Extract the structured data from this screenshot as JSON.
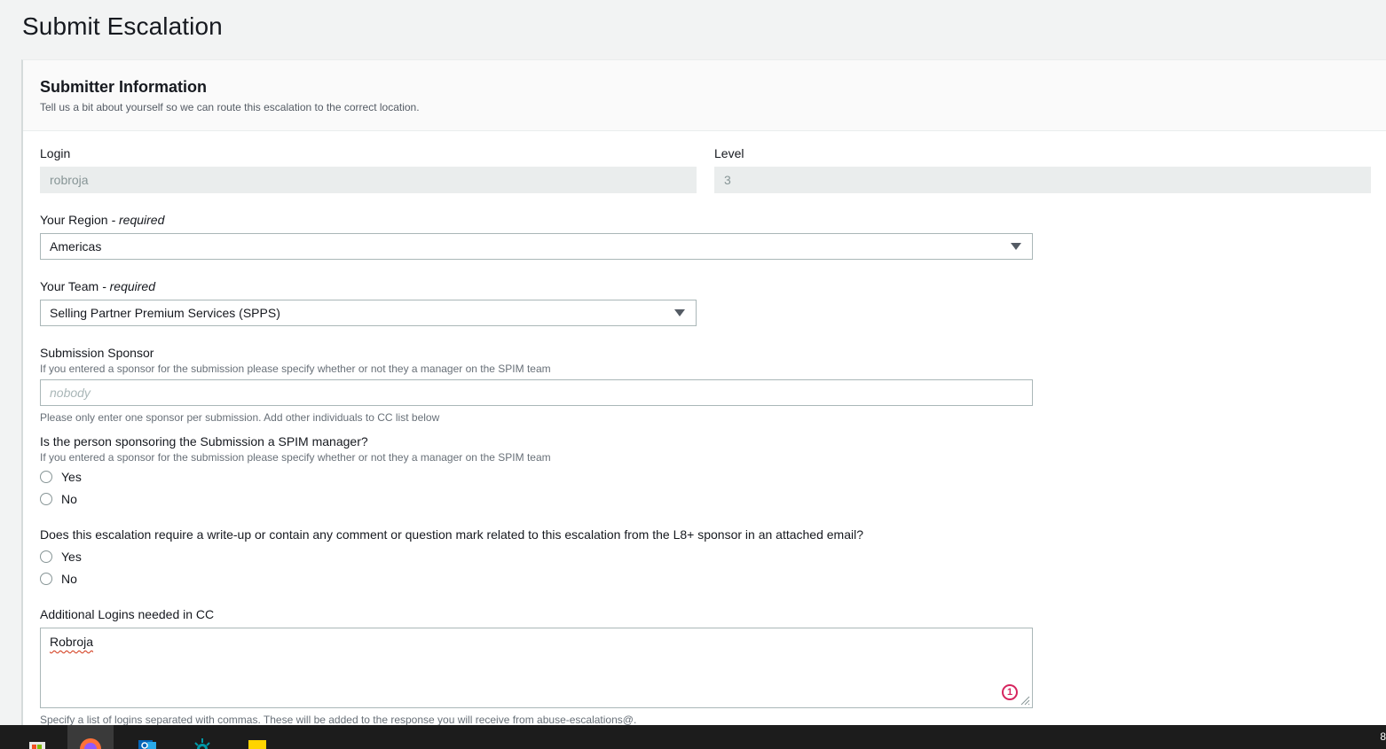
{
  "page": {
    "title": "Submit Escalation"
  },
  "section": {
    "title": "Submitter Information",
    "description": "Tell us a bit about yourself so we can route this escalation to the correct location."
  },
  "fields": {
    "login": {
      "label": "Login",
      "value": "robroja"
    },
    "level": {
      "label": "Level",
      "value": "3"
    },
    "region": {
      "label": "Your Region",
      "required_text": "- required",
      "value": "Americas"
    },
    "team": {
      "label": "Your Team",
      "required_text": "- required",
      "value": "Selling Partner Premium Services (SPPS)"
    },
    "sponsor": {
      "label": "Submission Sponsor",
      "hint": "If you entered a sponsor for the submission please specify whether or not they a manager on the SPIM team",
      "placeholder": "nobody",
      "footer": "Please only enter one sponsor per submission. Add other individuals to CC list below"
    },
    "spim_manager": {
      "label": "Is the person sponsoring the Submission a SPIM manager?",
      "hint": "If you entered a sponsor for the submission please specify whether or not they a manager on the SPIM team",
      "options": [
        "Yes",
        "No"
      ]
    },
    "writeup": {
      "label": "Does this escalation require a write-up or contain any comment or question mark related to this escalation from the L8+ sponsor in an attached email?",
      "options": [
        "Yes",
        "No"
      ]
    },
    "cc": {
      "label": "Additional Logins needed in CC",
      "value": "Robroja",
      "badge": "1",
      "footer": "Specify a list of logins separated with commas. These will be added to the response you will receive from abuse-escalations@."
    }
  },
  "icons": {
    "caret": "chevron-down-icon",
    "spellcheck_badge": "grammarly-icon",
    "resize": "resize-handle-icon"
  },
  "colors": {
    "accent_error": "#d13212",
    "badge": "#d6245e",
    "taskbar": "#1c1c1c"
  },
  "taskbar": {
    "clock": "8"
  }
}
